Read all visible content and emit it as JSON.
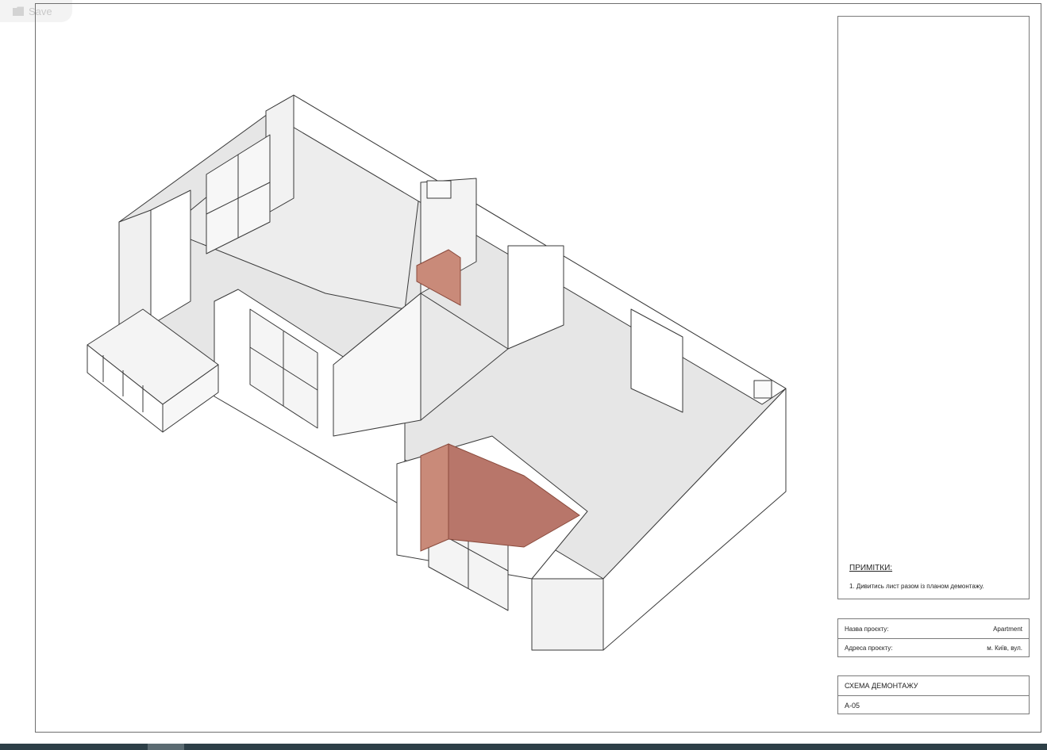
{
  "toolbar": {
    "save_label": "Save",
    "save_icon": "folder-icon"
  },
  "notes": {
    "title": "ПРИМІТКИ:",
    "items": [
      "1. Дивитись лист разом із планом демонтажу."
    ]
  },
  "project_info": {
    "name_label": "Назва проєкту:",
    "name_value": "Apartment",
    "address_label": "Адреса проєкту:",
    "address_value": "м. Київ, вул."
  },
  "sheet": {
    "title": "СХЕМА ДЕМОНТАЖУ",
    "number": "А-05"
  },
  "colors": {
    "demolition": "#c98a79",
    "wall": "#ffffff",
    "floor": "#e2e2e2",
    "line": "#3a3a3a"
  }
}
